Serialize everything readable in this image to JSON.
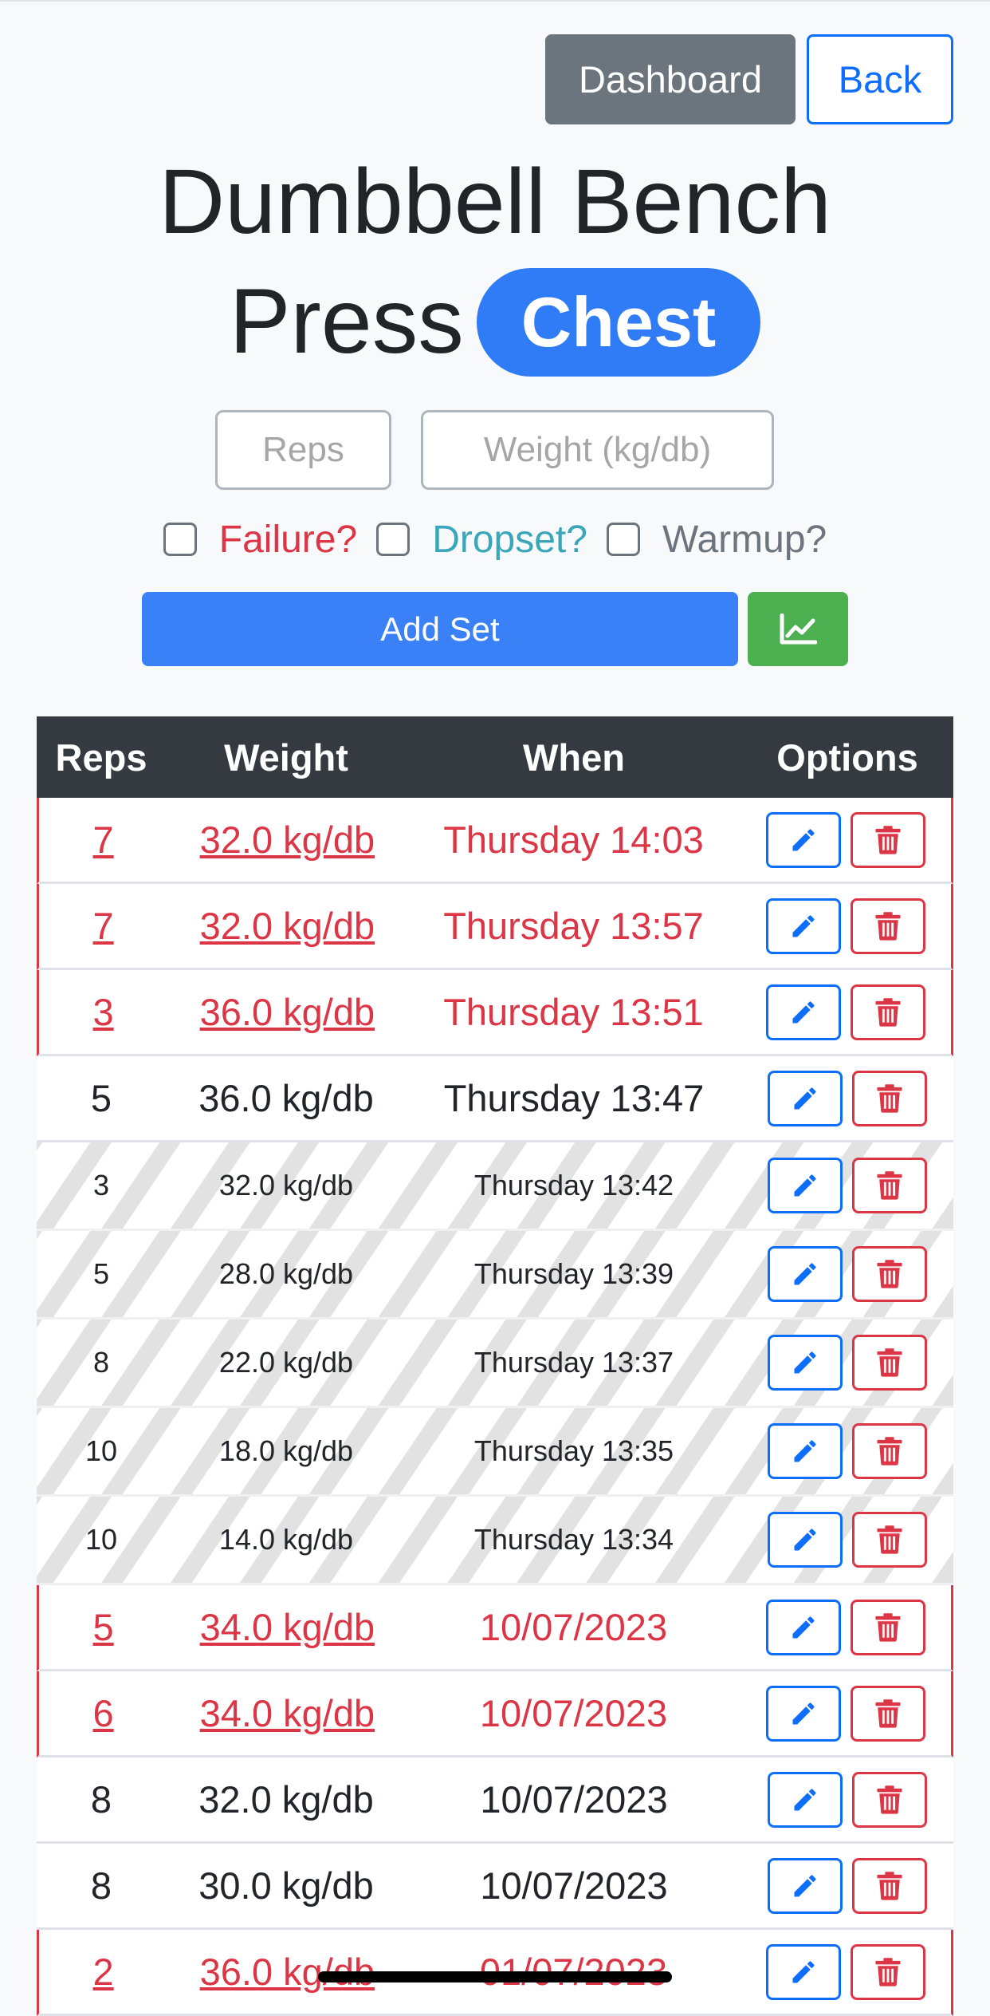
{
  "nav": {
    "dashboard_label": "Dashboard",
    "back_label": "Back"
  },
  "exercise": {
    "name": "Dumbbell Bench Press",
    "muscle_group": "Chest"
  },
  "form": {
    "reps_placeholder": "Reps",
    "weight_placeholder": "Weight (kg/db)",
    "failure_label": "Failure?",
    "dropset_label": "Dropset?",
    "warmup_label": "Warmup?",
    "add_set_label": "Add Set",
    "chart_icon": "chart-line-icon"
  },
  "table": {
    "headers": {
      "reps": "Reps",
      "weight": "Weight",
      "when": "When",
      "options": "Options"
    },
    "edit_icon": "pencil-icon",
    "delete_icon": "trash-icon",
    "rows": [
      {
        "reps": "7",
        "weight": "32.0 kg/db",
        "when": "Thursday 14:03",
        "type": "failure"
      },
      {
        "reps": "7",
        "weight": "32.0 kg/db",
        "when": "Thursday 13:57",
        "type": "failure"
      },
      {
        "reps": "3",
        "weight": "36.0 kg/db",
        "when": "Thursday 13:51",
        "type": "failure"
      },
      {
        "reps": "5",
        "weight": "36.0 kg/db",
        "when": "Thursday 13:47",
        "type": "normal"
      },
      {
        "reps": "3",
        "weight": "32.0 kg/db",
        "when": "Thursday 13:42",
        "type": "warmup"
      },
      {
        "reps": "5",
        "weight": "28.0 kg/db",
        "when": "Thursday 13:39",
        "type": "warmup"
      },
      {
        "reps": "8",
        "weight": "22.0 kg/db",
        "when": "Thursday 13:37",
        "type": "warmup"
      },
      {
        "reps": "10",
        "weight": "18.0 kg/db",
        "when": "Thursday 13:35",
        "type": "warmup"
      },
      {
        "reps": "10",
        "weight": "14.0 kg/db",
        "when": "Thursday 13:34",
        "type": "warmup"
      },
      {
        "reps": "5",
        "weight": "34.0 kg/db",
        "when": "10/07/2023",
        "type": "failure"
      },
      {
        "reps": "6",
        "weight": "34.0 kg/db",
        "when": "10/07/2023",
        "type": "failure"
      },
      {
        "reps": "8",
        "weight": "32.0 kg/db",
        "when": "10/07/2023",
        "type": "normal"
      },
      {
        "reps": "8",
        "weight": "30.0 kg/db",
        "when": "10/07/2023",
        "type": "normal"
      },
      {
        "reps": "2",
        "weight": "36.0 kg/db",
        "when": "01/07/2023",
        "type": "failure"
      }
    ]
  },
  "colors": {
    "primary": "#0d6efd",
    "danger": "#dc3545",
    "info": "#3aa6b9",
    "secondary": "#6c757d",
    "success": "#4caf50",
    "dark": "#343a40"
  }
}
